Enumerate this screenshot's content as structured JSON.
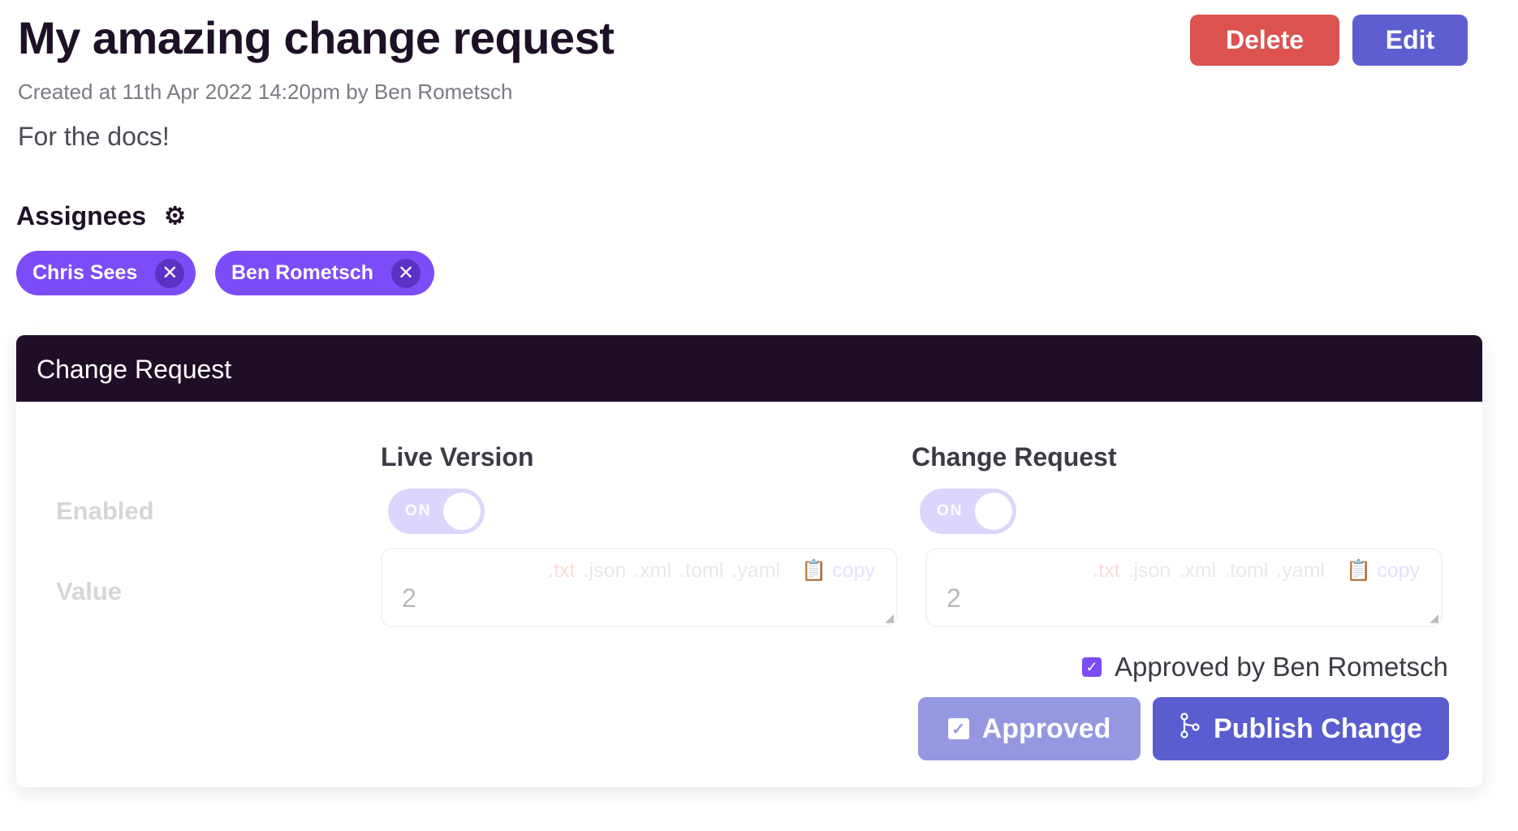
{
  "header": {
    "title": "My amazing change request",
    "created": "Created at 11th Apr 2022 14:20pm by Ben Rometsch",
    "description": "For the docs!",
    "delete_label": "Delete",
    "edit_label": "Edit"
  },
  "assignees": {
    "heading": "Assignees",
    "people": [
      "Chris Sees",
      "Ben Rometsch"
    ]
  },
  "card": {
    "title": "Change Request",
    "columns": [
      "Live Version",
      "Change Request"
    ],
    "rows": {
      "enabled": "Enabled",
      "value": "Value"
    },
    "live": {
      "toggle": "ON",
      "value": "2"
    },
    "change": {
      "toggle": "ON",
      "value": "2"
    },
    "formats": [
      ".txt",
      ".json",
      ".xml",
      ".toml",
      ".yaml"
    ],
    "copy_label": "copy",
    "approved_by": "Approved by Ben Rometsch",
    "approved_label": "Approved",
    "publish_label": "Publish Change"
  },
  "colors": {
    "delete": "#dc524f",
    "primary": "#5d5fd0",
    "chip": "#7b4cf7",
    "header": "#1e0e26"
  }
}
